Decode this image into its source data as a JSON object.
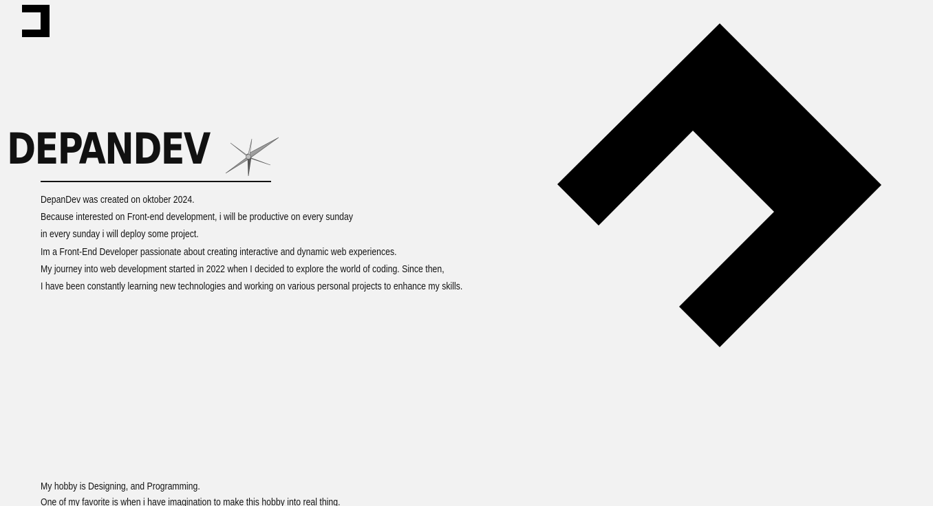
{
  "header": {
    "logo_icon": "bracket-logo-icon"
  },
  "hero": {
    "title": "DEPANDEV",
    "star_icon": "sparkle-star-icon"
  },
  "intro": {
    "lines": [
      "DepanDev was created on oktober 2024.",
      "Because interested on Front-end development, i will be productive on every sunday",
      "in every sunday i will deploy some project.",
      "Im a Front-End Developer passionate about creating interactive and dynamic web experiences.",
      "My journey into web development started in 2022 when I decided to explore the world of coding. Since then,",
      "I have been constantly learning new technologies and working on various personal projects to enhance my skills."
    ]
  },
  "decor": {
    "chevron_icon": "chevron-arrow-icon",
    "color": "#000000"
  },
  "hobby": {
    "lines": [
      "My hobby is Designing, and Programming.",
      "One of my favorite is when i have imagination to make this hobby into real thing."
    ]
  },
  "colors": {
    "background": "#f2f2f2",
    "text": "#111111"
  }
}
